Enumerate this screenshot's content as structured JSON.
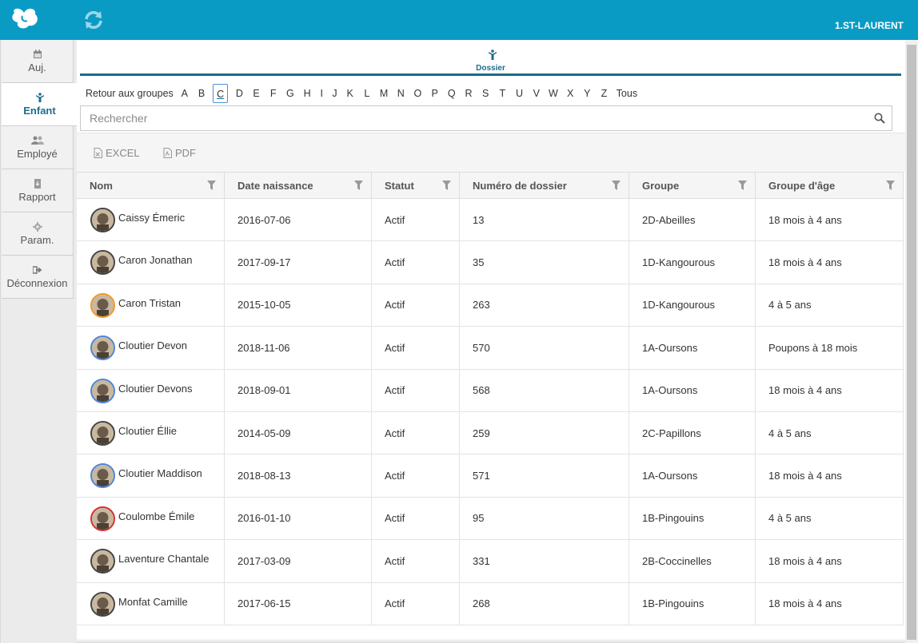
{
  "header": {
    "site_name": "1.ST-LAURENT",
    "bg_color": "#0a9bc4"
  },
  "sidebar": {
    "items": [
      {
        "label": "Auj.",
        "icon": "calendar-icon"
      },
      {
        "label": "Enfant",
        "icon": "child-icon",
        "active": true
      },
      {
        "label": "Employé",
        "icon": "people-icon"
      },
      {
        "label": "Rapport",
        "icon": "report-download-icon"
      },
      {
        "label": "Param.",
        "icon": "gear-icon"
      },
      {
        "label": "Déconnexion",
        "icon": "logout-icon"
      }
    ]
  },
  "tab": {
    "label": "Dossier",
    "icon": "child-icon"
  },
  "alphabet": {
    "back_label": "Retour aux groupes",
    "letters": [
      "A",
      "B",
      "C",
      "D",
      "E",
      "F",
      "G",
      "H",
      "I",
      "J",
      "K",
      "L",
      "M",
      "N",
      "O",
      "P",
      "Q",
      "R",
      "S",
      "T",
      "U",
      "V",
      "W",
      "X",
      "Y",
      "Z"
    ],
    "selected": "C",
    "all_label": "Tous"
  },
  "search": {
    "placeholder": "Rechercher",
    "value": ""
  },
  "toolbar": {
    "excel_label": "EXCEL",
    "pdf_label": "PDF"
  },
  "table": {
    "columns": [
      "Nom",
      "Date naissance",
      "Statut",
      "Numéro de dossier",
      "Groupe",
      "Groupe d'âge"
    ],
    "rows": [
      {
        "name": "Caissy Émeric",
        "dob": "2016-07-06",
        "status": "Actif",
        "file": "13",
        "group": "2D-Abeilles",
        "age_group": "18 mois à 4 ans",
        "avatar": "dark"
      },
      {
        "name": "Caron Jonathan",
        "dob": "2017-09-17",
        "status": "Actif",
        "file": "35",
        "group": "1D-Kangourous",
        "age_group": "18 mois à 4 ans",
        "avatar": "dark"
      },
      {
        "name": "Caron Tristan",
        "dob": "2015-10-05",
        "status": "Actif",
        "file": "263",
        "group": "1D-Kangourous",
        "age_group": "4 à 5 ans",
        "avatar": "orange"
      },
      {
        "name": "Cloutier Devon",
        "dob": "2018-11-06",
        "status": "Actif",
        "file": "570",
        "group": "1A-Oursons",
        "age_group": "Poupons à 18 mois",
        "avatar": "blue"
      },
      {
        "name": "Cloutier Devons",
        "dob": "2018-09-01",
        "status": "Actif",
        "file": "568",
        "group": "1A-Oursons",
        "age_group": "18 mois à 4 ans",
        "avatar": "blue"
      },
      {
        "name": "Cloutier Éllie",
        "dob": "2014-05-09",
        "status": "Actif",
        "file": "259",
        "group": "2C-Papillons",
        "age_group": "4 à 5 ans",
        "avatar": "dark"
      },
      {
        "name": "Cloutier Maddison",
        "dob": "2018-08-13",
        "status": "Actif",
        "file": "571",
        "group": "1A-Oursons",
        "age_group": "18 mois à 4 ans",
        "avatar": "blue"
      },
      {
        "name": "Coulombe Émile",
        "dob": "2016-01-10",
        "status": "Actif",
        "file": "95",
        "group": "1B-Pingouins",
        "age_group": "4 à 5 ans",
        "avatar": "red"
      },
      {
        "name": "Laventure Chantale",
        "dob": "2017-03-09",
        "status": "Actif",
        "file": "331",
        "group": "2B-Coccinelles",
        "age_group": "18 mois à 4 ans",
        "avatar": "dark"
      },
      {
        "name": "Monfat Camille",
        "dob": "2017-06-15",
        "status": "Actif",
        "file": "268",
        "group": "1B-Pingouins",
        "age_group": "18 mois à 4 ans",
        "avatar": "dark"
      }
    ]
  }
}
